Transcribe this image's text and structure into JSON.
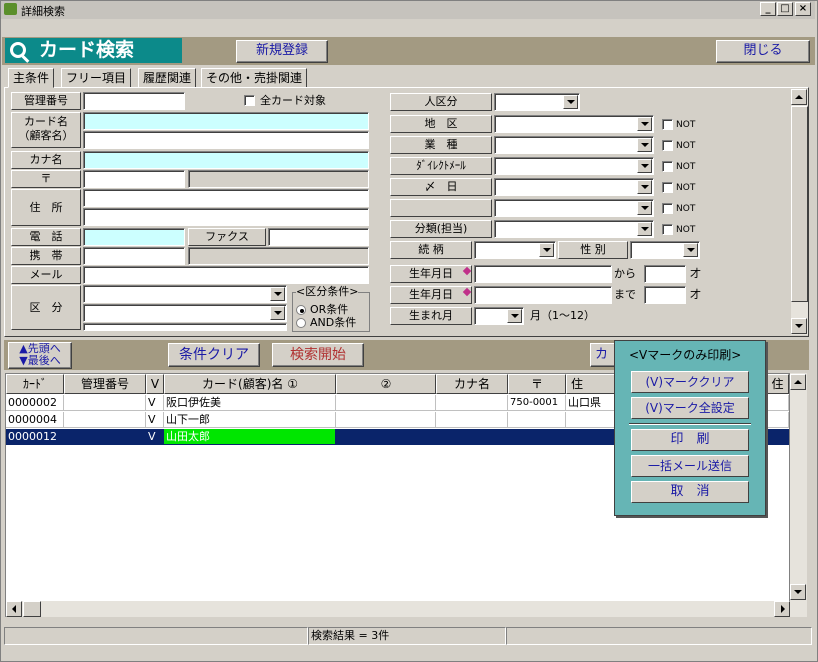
{
  "window": {
    "title": "詳細検索",
    "min": "_",
    "max": "□",
    "close": "×"
  },
  "header": {
    "card_search": "カード検索",
    "new_register": "新規登録",
    "close_button": "閉じる"
  },
  "tabs": [
    "主条件",
    "フリー項目",
    "履歴関連",
    "その他・売掛関連"
  ],
  "form": {
    "kanri_bango": "管理番号",
    "all_cards": "全カード対象",
    "card_name": "カード名",
    "customer_name": "（顧客名）",
    "kana": "カナ名",
    "postal": "〒",
    "address": "住　所",
    "phone": "電　話",
    "fax": "ファクス",
    "mobile": "携　帯",
    "mail": "メール",
    "division": "区　分",
    "cond_group": "<区分条件>",
    "or_cond": "OR条件",
    "and_cond": "AND条件",
    "person_div": "人区分",
    "area": "地　区",
    "industry": "業　種",
    "direct_mail": "ﾀﾞｲﾚｸﾄﾒｰﾙ",
    "deadline": "〆　日",
    "category_staff": "分類(担当)",
    "relation": "続 柄",
    "gender": "性 別",
    "birth1": "生年月日",
    "birth2": "生年月日",
    "birth_month": "生まれ月",
    "from": "から",
    "to": "まで",
    "age": "才",
    "month_range": "月（1～12）",
    "not": "NOT"
  },
  "actions": {
    "top": "▲先頭へ",
    "bottom": "▼最後へ",
    "clear": "条件クリア",
    "search": "検索開始",
    "card_btn": "カー"
  },
  "table": {
    "headers": [
      "ｶｰﾄﾞ",
      "管理番号",
      "V",
      "カード(顧客)名 ①",
      "②",
      "カナ名",
      "〒",
      "住",
      "住"
    ],
    "rows": [
      {
        "card": "0000002",
        "kanri": "",
        "v": "V",
        "name1": "阪口伊佐美",
        "name2": "",
        "kana": "",
        "postal": "750-0001",
        "addr": "山口県"
      },
      {
        "card": "0000004",
        "kanri": "",
        "v": "V",
        "name1": "山下一郎",
        "name2": "",
        "kana": "",
        "postal": "",
        "addr": ""
      },
      {
        "card": "0000012",
        "kanri": "",
        "v": "V",
        "name1": "山田太郎",
        "name2": "",
        "kana": "",
        "postal": "",
        "addr": ""
      }
    ]
  },
  "popup": {
    "title": "<Vマークのみ印刷>",
    "clear_v": "(V)マーククリア",
    "set_all_v": "(V)マーク全設定",
    "print": "印　刷",
    "bulk_mail": "一括メール送信",
    "cancel": "取　消"
  },
  "status": {
    "result": "検索結果 = 3件"
  }
}
